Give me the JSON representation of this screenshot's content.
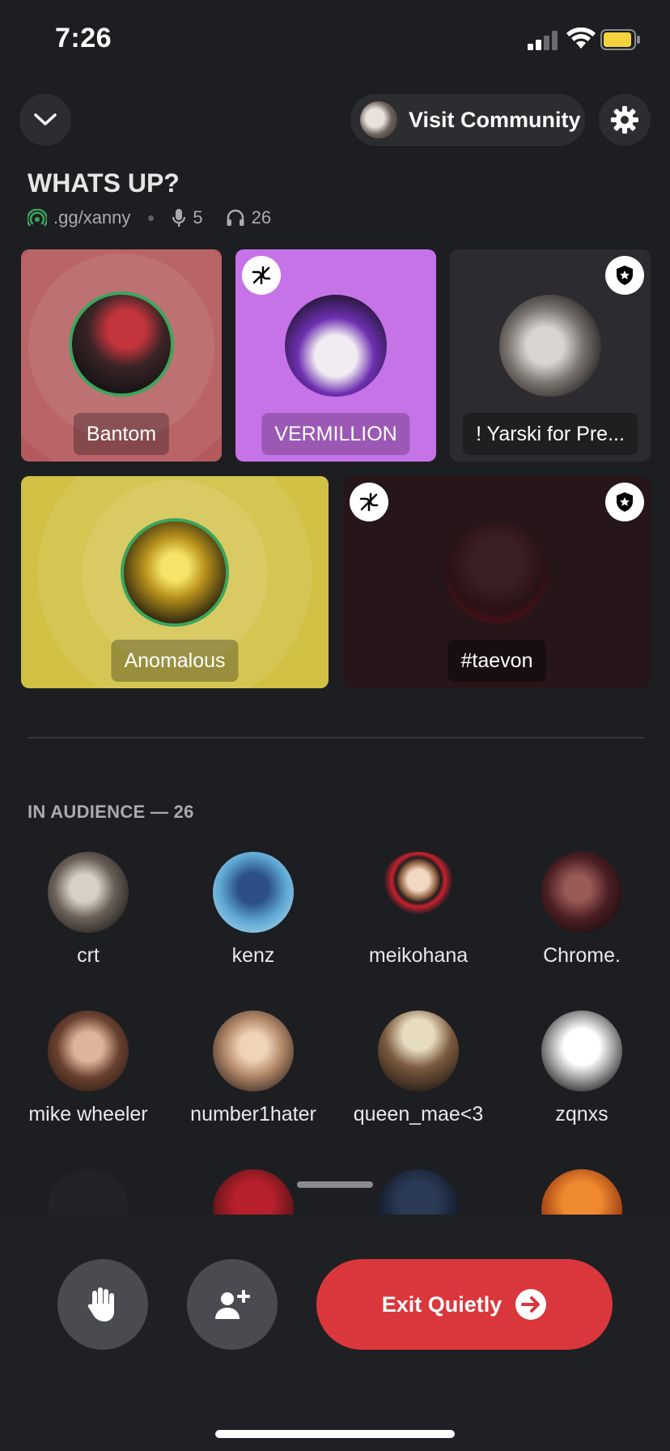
{
  "status_bar": {
    "time": "7:26"
  },
  "header": {
    "visit_label": "Visit Community"
  },
  "stage": {
    "title": "WHATS UP?",
    "invite": ".gg/xanny",
    "speaker_count": "5",
    "listener_count": "26"
  },
  "speakers": [
    {
      "name": "Bantom",
      "bg": "#b45a5d",
      "speaking": true
    },
    {
      "name": "VERMILLION",
      "bg": "#c773e8",
      "muted": true
    },
    {
      "name": "! Yarski for Pre...",
      "bg": "#2c2b30",
      "moderator": true
    },
    {
      "name": "Anomalous",
      "bg": "#d1c043",
      "speaking": true
    },
    {
      "name": "#taevon",
      "bg": "#261519",
      "muted": true,
      "moderator": true
    }
  ],
  "audience": {
    "title": "IN AUDIENCE — 26",
    "members": [
      "crt",
      "kenz",
      "meikohana",
      "Chrome.",
      "mike wheeler",
      "number1hater",
      "queen_mae<3",
      "zqnxs"
    ]
  },
  "actions": {
    "exit_label": "Exit Quietly"
  },
  "colors": {
    "accent_red": "#da373c",
    "speaking_ring": "#3ba55c"
  }
}
